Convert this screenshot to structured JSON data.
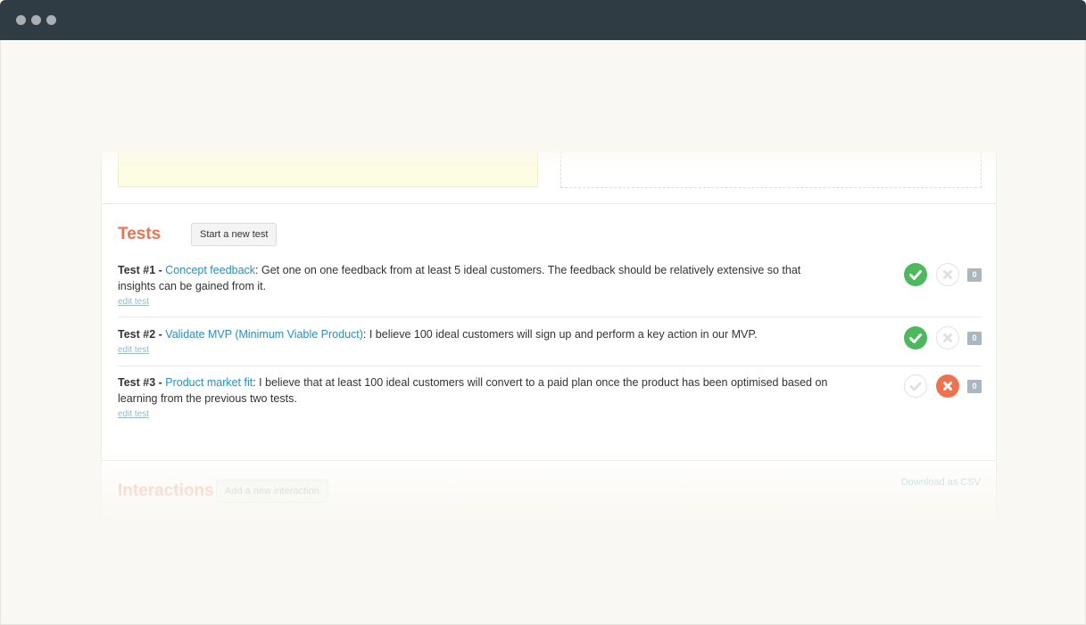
{
  "tests_section": {
    "title": "Tests",
    "new_button": "Start a new test",
    "items": [
      {
        "prefix": "Test #1 -",
        "link": "Concept feedback",
        "description": ": Get one on one feedback from at least 5 ideal customers. The feedback should be relatively extensive so that insights can be gained from it.",
        "edit_label": "edit test",
        "status": "passed",
        "count": "0"
      },
      {
        "prefix": "Test #2 -",
        "link": "Validate MVP (Minimum Viable Product)",
        "description": ": I believe 100 ideal customers will sign up and perform a key action in our MVP.",
        "edit_label": "edit test",
        "status": "passed",
        "count": "0"
      },
      {
        "prefix": "Test #3 -",
        "link": "Product market fit",
        "description": ": I believe that at least 100 ideal customers will convert to a paid plan once the product has been optimised based on learning from the previous two tests.",
        "edit_label": "edit test",
        "status": "failed",
        "count": "0"
      }
    ]
  },
  "interactions_section": {
    "title": "Interactions",
    "new_button": "Add a new interaction",
    "csv_link": "Download as CSV"
  },
  "colors": {
    "accent": "#f0714d",
    "link": "#2b8fc0",
    "pass": "#4cb95c",
    "fail": "#f0714d",
    "titlebar": "#2f3c44"
  },
  "icons": {
    "pass": "check-circle-icon",
    "fail": "x-circle-icon"
  }
}
